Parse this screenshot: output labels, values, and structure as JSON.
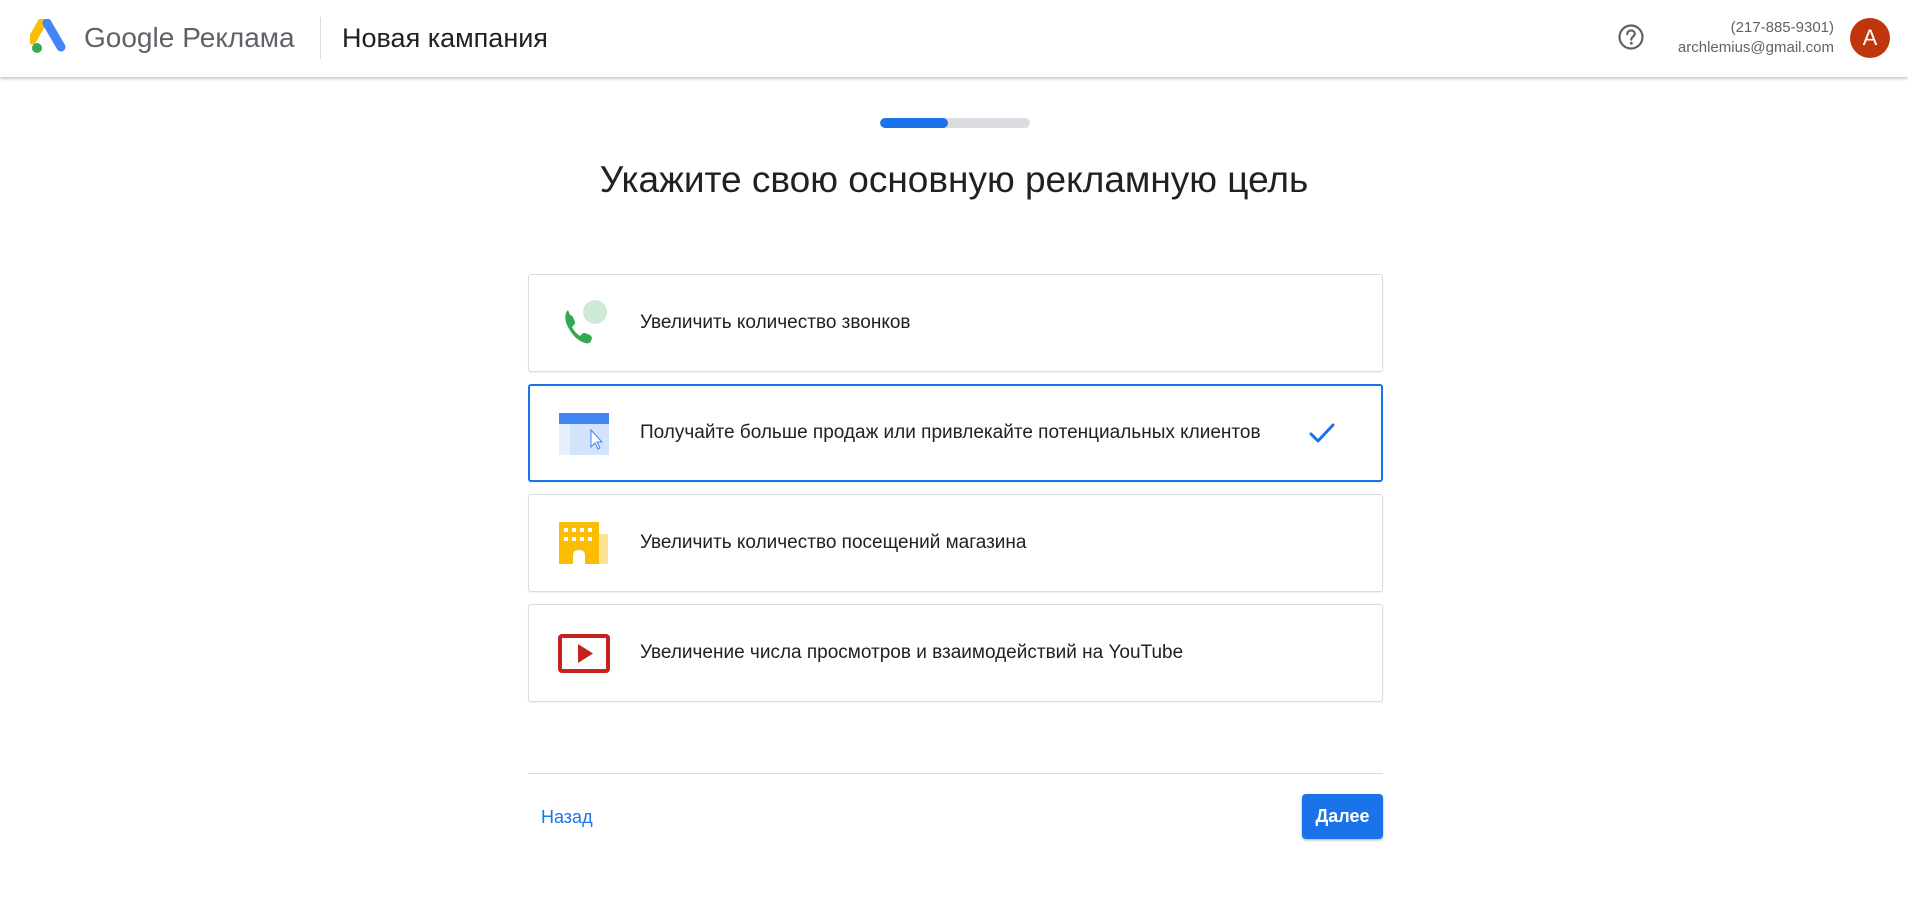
{
  "header": {
    "brand_google": "Google",
    "brand_product": "Реклама",
    "title": "Новая кампания",
    "help_icon": "help-circle-icon",
    "account_phone": "(217-885-9301)",
    "account_email": "archlemius@gmail.com",
    "avatar_letter": "A",
    "avatar_color": "#bf360c"
  },
  "progress": {
    "fraction": 0.45,
    "color": "#1a73e8"
  },
  "main": {
    "title": "Укажите свою основную рекламную цель"
  },
  "options": [
    {
      "icon": "phone-call-icon",
      "label": "Увеличить количество звонков",
      "selected": false
    },
    {
      "icon": "website-click-icon",
      "label": "Получайте больше продаж или привлекайте потенциальных клиентов",
      "selected": true
    },
    {
      "icon": "store-building-icon",
      "label": "Увеличить количество посещений магазина",
      "selected": false
    },
    {
      "icon": "youtube-play-icon",
      "label": "Увеличение числа просмотров и взаимодействий на YouTube",
      "selected": false
    }
  ],
  "footer": {
    "back_label": "Назад",
    "next_label": "Далее"
  },
  "colors": {
    "accent": "#1a73e8",
    "phone_green": "#34a853",
    "store_yellow": "#fbbc04",
    "youtube_red": "#c5221f"
  }
}
